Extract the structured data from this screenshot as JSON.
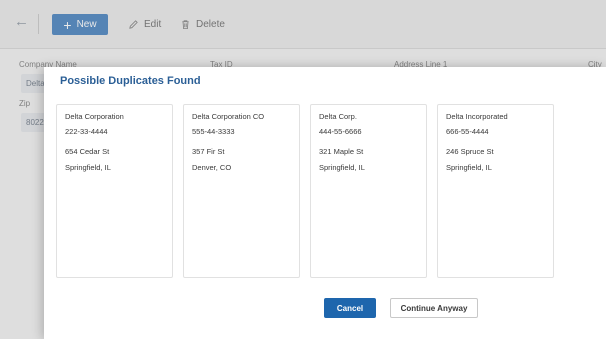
{
  "toolbar": {
    "back_icon": "arrow-left-icon",
    "new_label": "New",
    "edit_label": "Edit",
    "delete_label": "Delete"
  },
  "form": {
    "company_name_label": "Company Name",
    "company_name_value": "Delta",
    "tax_id_label": "Tax ID",
    "address_line_label": "Address Line 1",
    "city_label": "City",
    "zip_label": "Zip",
    "zip_value": "8022"
  },
  "dialog": {
    "title": "Possible Duplicates Found",
    "cards": [
      {
        "name": "Delta Corporation",
        "tax_id": "222-33-4444",
        "address": "654 Cedar St",
        "city": "Springfield, IL"
      },
      {
        "name": "Delta Corporation CO",
        "tax_id": "555-44-3333",
        "address": "357 Fir St",
        "city": "Denver, CO"
      },
      {
        "name": "Delta Corp.",
        "tax_id": "444-55-6666",
        "address": "321 Maple St",
        "city": "Springfield, IL"
      },
      {
        "name": "Delta Incorporated",
        "tax_id": "666-55-4444",
        "address": "246 Spruce St",
        "city": "Springfield, IL"
      }
    ],
    "cancel_label": "Cancel",
    "continue_label": "Continue Anyway"
  },
  "colors": {
    "primary": "#1e66ad",
    "title": "#2b5f96",
    "new_button": "#5b8fc6"
  }
}
